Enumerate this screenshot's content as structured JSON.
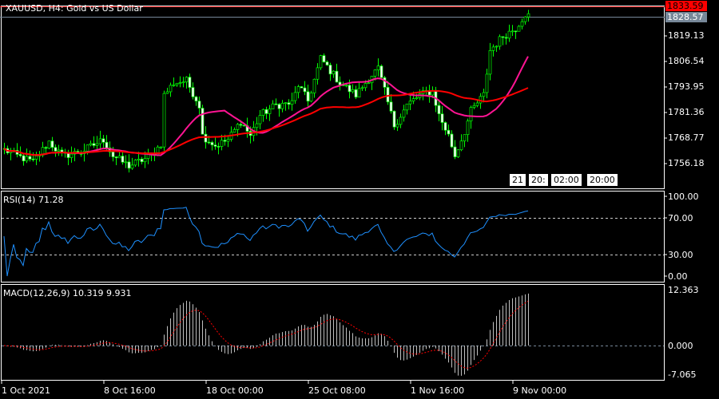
{
  "header": {
    "title": "XAUUSD, H4:  Gold vs US Dollar"
  },
  "price_tags": {
    "ask": "1833.59",
    "bid": "1828.57"
  },
  "colors": {
    "ask": "#ff0000",
    "bid": "#778899",
    "candle": "#00ff00",
    "ma_fast": "#ff1493",
    "ma_slow": "#ff0000",
    "rsi": "#1e90ff",
    "macd_signal": "#ff0000",
    "macd_hist": "#c0c0c0"
  },
  "time_buttons": [
    "21",
    "20:",
    "02:00",
    "20:00"
  ],
  "rsi": {
    "label": "RSI(14) 71.28",
    "levels": [
      "100.00",
      "70.00",
      "30.00",
      "0.00"
    ]
  },
  "macd": {
    "label": "MACD(12,26,9) 10.319 9.931",
    "levels": [
      "12.363",
      "0.000",
      "-7.065"
    ]
  },
  "chart_data": {
    "type": "candlestick",
    "symbol": "XAUUSD",
    "timeframe": "H4",
    "y_ticks": [
      "1819.13",
      "1806.54",
      "1793.95",
      "1781.36",
      "1768.77",
      "1756.18"
    ],
    "ylim": [
      1750,
      1835
    ],
    "x_ticks": [
      "1 Oct 2021",
      "8 Oct 16:00",
      "18 Oct 00:00",
      "25 Oct 08:00",
      "1 Nov 16:00",
      "9 Nov 00:00"
    ],
    "close_keypoints": [
      [
        0,
        1763
      ],
      [
        4,
        1760
      ],
      [
        9,
        1757
      ],
      [
        14,
        1767
      ],
      [
        18,
        1760
      ],
      [
        24,
        1762
      ],
      [
        31,
        1768
      ],
      [
        34,
        1760
      ],
      [
        39,
        1755
      ],
      [
        46,
        1760
      ],
      [
        49,
        1766
      ],
      [
        50,
        1790
      ],
      [
        53,
        1796
      ],
      [
        57,
        1797
      ],
      [
        61,
        1785
      ],
      [
        62,
        1770
      ],
      [
        66,
        1765
      ],
      [
        70,
        1768
      ],
      [
        74,
        1777
      ],
      [
        77,
        1770
      ],
      [
        80,
        1780
      ],
      [
        85,
        1785
      ],
      [
        90,
        1786
      ],
      [
        92,
        1795
      ],
      [
        95,
        1787
      ],
      [
        99,
        1808
      ],
      [
        102,
        1802
      ],
      [
        105,
        1796
      ],
      [
        110,
        1790
      ],
      [
        115,
        1800
      ],
      [
        117,
        1803
      ],
      [
        122,
        1775
      ],
      [
        126,
        1785
      ],
      [
        130,
        1790
      ],
      [
        134,
        1792
      ],
      [
        136,
        1780
      ],
      [
        139,
        1770
      ],
      [
        141,
        1760
      ],
      [
        144,
        1772
      ],
      [
        146,
        1782
      ],
      [
        150,
        1790
      ],
      [
        152,
        1812
      ],
      [
        156,
        1819
      ],
      [
        160,
        1823
      ],
      [
        163,
        1830
      ],
      [
        164,
        1829
      ]
    ],
    "bar_count": 165
  }
}
